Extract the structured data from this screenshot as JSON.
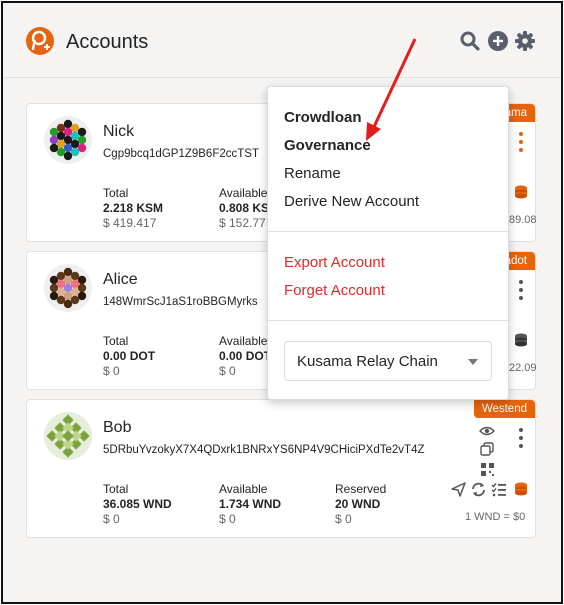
{
  "header": {
    "title": "Accounts",
    "icons": [
      "polkadot-logo-icon",
      "search-icon",
      "add-account-icon",
      "settings-gear-icon"
    ]
  },
  "accounts": [
    {
      "name": "Nick",
      "address": "Cgp9bcq1dGP1Z9B6F2ccTST",
      "chain_tag": "ama",
      "balances": [
        {
          "label": "Total",
          "value": "2.218 KSM",
          "fiat": "$ 419.417"
        },
        {
          "label": "Available",
          "value": "0.808 KS",
          "fiat": "$ 152.77"
        }
      ],
      "rate": "89.08"
    },
    {
      "name": "Alice",
      "address": "148WmrScJ1aS1roBBGMyrks",
      "chain_tag": "adot",
      "balances": [
        {
          "label": "Total",
          "value": "0.00 DOT",
          "fiat": "$ 0"
        },
        {
          "label": "Available",
          "value": "0.00 DOT",
          "fiat": "$ 0"
        }
      ],
      "rate": "22.09"
    },
    {
      "name": "Bob",
      "address": "5DRbuYvzokyX7X4QDxrk1BNRxYS6NP4V9CHiciPXdTe2vT4Z",
      "chain_tag": "Westend",
      "balances": [
        {
          "label": "Total",
          "value": "36.085 WND",
          "fiat": "$ 0"
        },
        {
          "label": "Available",
          "value": "1.734 WND",
          "fiat": "$ 0"
        },
        {
          "label": "Reserved",
          "value": "20 WND",
          "fiat": "$ 0"
        }
      ],
      "rate": "1 WND = $0"
    }
  ],
  "menu": {
    "items_primary": [
      "Crowdloan",
      "Governance"
    ],
    "items_secondary": [
      "Rename",
      "Derive New Account"
    ],
    "items_danger": [
      "Export Account",
      "Forget Account"
    ],
    "chain_select": "Kusama Relay Chain"
  },
  "colors": {
    "accent": "#e6640e",
    "danger": "#e02b2b",
    "background": "#f5f4f3",
    "annotation_arrow": "#e21d1d"
  }
}
